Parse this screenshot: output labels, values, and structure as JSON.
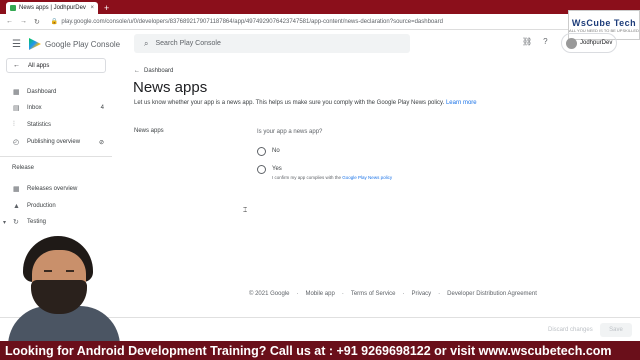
{
  "browser": {
    "tab_title": "News apps | JodhpurDev",
    "tab_close": "×",
    "new_tab": "+",
    "back": "←",
    "forward": "→",
    "reload": "↻",
    "lock": "🔒",
    "url": "play.google.com/console/u/0/developers/8376892179071187864/app/4974929076423747581/app-content/news-declaration?source=dashboard"
  },
  "logo": {
    "text": "WsCube Tech",
    "sub": "ALL YOU NEED IS TO BE UPSKILLED"
  },
  "header": {
    "menu_icon": "☰",
    "app_title": "Google Play Console",
    "search_icon": "⌕",
    "search_placeholder": "Search Play Console",
    "link_icon": "⛓",
    "help_icon": "?",
    "account_name": "JodhpurDev"
  },
  "sidebar": {
    "all_apps": "All apps",
    "all_apps_arrow": "←",
    "items": [
      {
        "label": "Dashboard",
        "icon": "▦"
      },
      {
        "label": "Inbox",
        "icon": "▤",
        "badge": "4"
      },
      {
        "label": "Statistics",
        "icon": "⫶"
      },
      {
        "label": "Publishing overview",
        "icon": "◴",
        "badge": "⊘"
      }
    ],
    "release_label": "Release",
    "release_items": [
      {
        "label": "Releases overview",
        "icon": "▦"
      },
      {
        "label": "Production",
        "icon": "▲"
      },
      {
        "label": "Testing",
        "icon": "↻",
        "expand": "▾"
      }
    ]
  },
  "main": {
    "breadcrumb": "Dashboard",
    "breadcrumb_arrow": "←",
    "title": "News apps",
    "description": "Let us know whether your app is a news app. This helps us make sure you comply with the Google Play News policy.",
    "learn_more": "Learn more",
    "field_label": "News apps",
    "question": "Is your app a news app?",
    "option_no": "No",
    "option_yes": "Yes",
    "confirm_text": "I confirm my app complies with the",
    "confirm_link": "Google Play News policy",
    "cursor": "⌶"
  },
  "footer": {
    "links": [
      "© 2021 Google",
      "·",
      "Mobile app",
      "·",
      "Terms of Service",
      "·",
      "Privacy",
      "·",
      "Developer Distribution Agreement"
    ]
  },
  "actions": {
    "discard": "Discard changes",
    "save": "Save"
  },
  "banner": "Looking for Android Development Training? Call us at : +91 9269698122 or visit www.wscubetech.com"
}
